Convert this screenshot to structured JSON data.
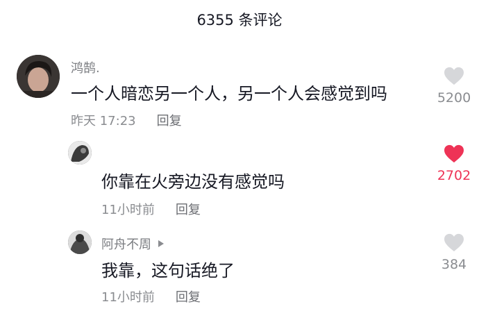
{
  "header": {
    "title": "6355 条评论"
  },
  "comments": [
    {
      "author": "鸿鹄.",
      "text": "一个人暗恋另一个人，另一个人会感觉到吗",
      "time": "昨天 17:23",
      "reply_label": "回复",
      "likes": "5200",
      "liked": false
    },
    {
      "author": "",
      "text": "你靠在火旁边没有感觉吗",
      "time": "11小时前",
      "reply_label": "回复",
      "likes": "2702",
      "liked": true
    },
    {
      "author": "阿舟不周",
      "text": "我靠，这句话绝了",
      "time": "11小时前",
      "reply_label": "回复",
      "likes": "384",
      "liked": false
    }
  ],
  "colors": {
    "liked": "#ee3356",
    "unliked": "#d6d7da",
    "text": "#161823",
    "secondary": "#8a8c90"
  },
  "icons": [
    "heart-outline-icon",
    "heart-filled-icon",
    "play-triangle-icon"
  ]
}
